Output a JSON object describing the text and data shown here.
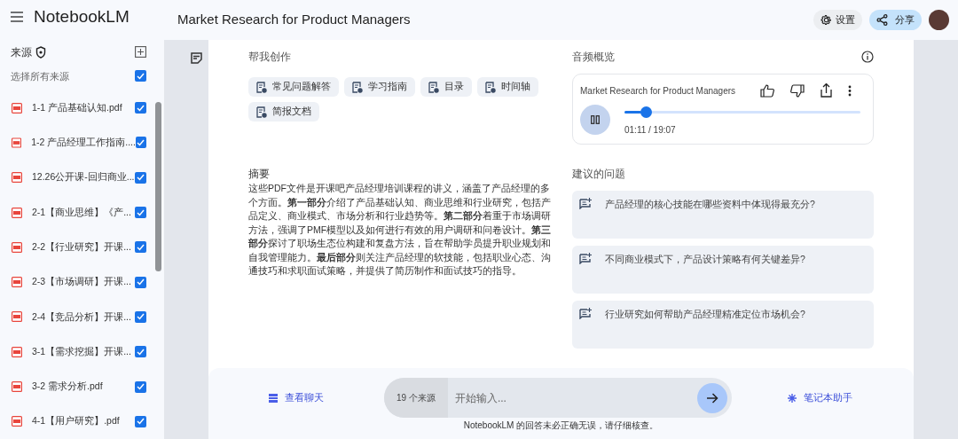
{
  "app": {
    "name": "NotebookLM"
  },
  "header": {
    "title": "Market Research for Product Managers",
    "settings_label": "设置",
    "share_label": "分享"
  },
  "sources": {
    "title": "来源",
    "select_all": {
      "label": "选择所有来源",
      "checked": true
    },
    "items": [
      {
        "name": "1-1 产品基础认知.pdf",
        "checked": true
      },
      {
        "name": "1-2 产品经理工作指南....",
        "checked": true
      },
      {
        "name": "12.26公开课-回归商业...",
        "checked": true
      },
      {
        "name": "2-1【商业思维】《产...",
        "checked": true
      },
      {
        "name": "2-2【行业研究】开课...",
        "checked": true
      },
      {
        "name": "2-3【市场调研】开课...",
        "checked": true
      },
      {
        "name": "2-4【竞品分析】开课...",
        "checked": true
      },
      {
        "name": "3-1【需求挖掘】开课...",
        "checked": true
      },
      {
        "name": "3-2 需求分析.pdf",
        "checked": true
      },
      {
        "name": "4-1【用户研究】.pdf",
        "checked": true
      }
    ]
  },
  "create": {
    "title": "帮我创作",
    "buttons": [
      "常见问题解答",
      "学习指南",
      "目录",
      "时间轴",
      "简报文档"
    ]
  },
  "summary": {
    "title": "摘要",
    "text": "这些PDF文件是开课吧产品经理培训课程的讲义，涵盖了产品经理的多个方面。**第一部分**介绍了产品基础认知、商业思维和行业研究，包括产品定义、商业模式、市场分析和行业趋势等。**第二部分**着重于市场调研方法，强调了PMF模型以及如何进行有效的用户调研和问卷设计。**第三部分**探讨了职场生态位构建和复盘方法，旨在帮助学员提升职业规划和自我管理能力。**最后部分**则关注产品经理的软技能，包括职业心态、沟通技巧和求职面试策略，并提供了简历制作和面试技巧的指导。"
  },
  "audio": {
    "title": "音频概览",
    "track_title": "Market Research for Product Managers",
    "playing": true,
    "level": 0.07,
    "time": "01:11 / 19:07"
  },
  "suggested": {
    "title": "建议的问题",
    "questions": [
      "产品经理的核心技能在哪些资料中体现得最充分?",
      "不同商业模式下，产品设计策略有何关键差异?",
      "行业研究如何帮助产品经理精准定位市场机会?"
    ]
  },
  "chat_bar": {
    "view_chat": "查看聊天",
    "source_count": "19 个来源",
    "placeholder": "开始输入...",
    "assistant": "笔记本助手",
    "disclaimer": "NotebookLM 的回答未必正确无误，请仔细核查。"
  }
}
